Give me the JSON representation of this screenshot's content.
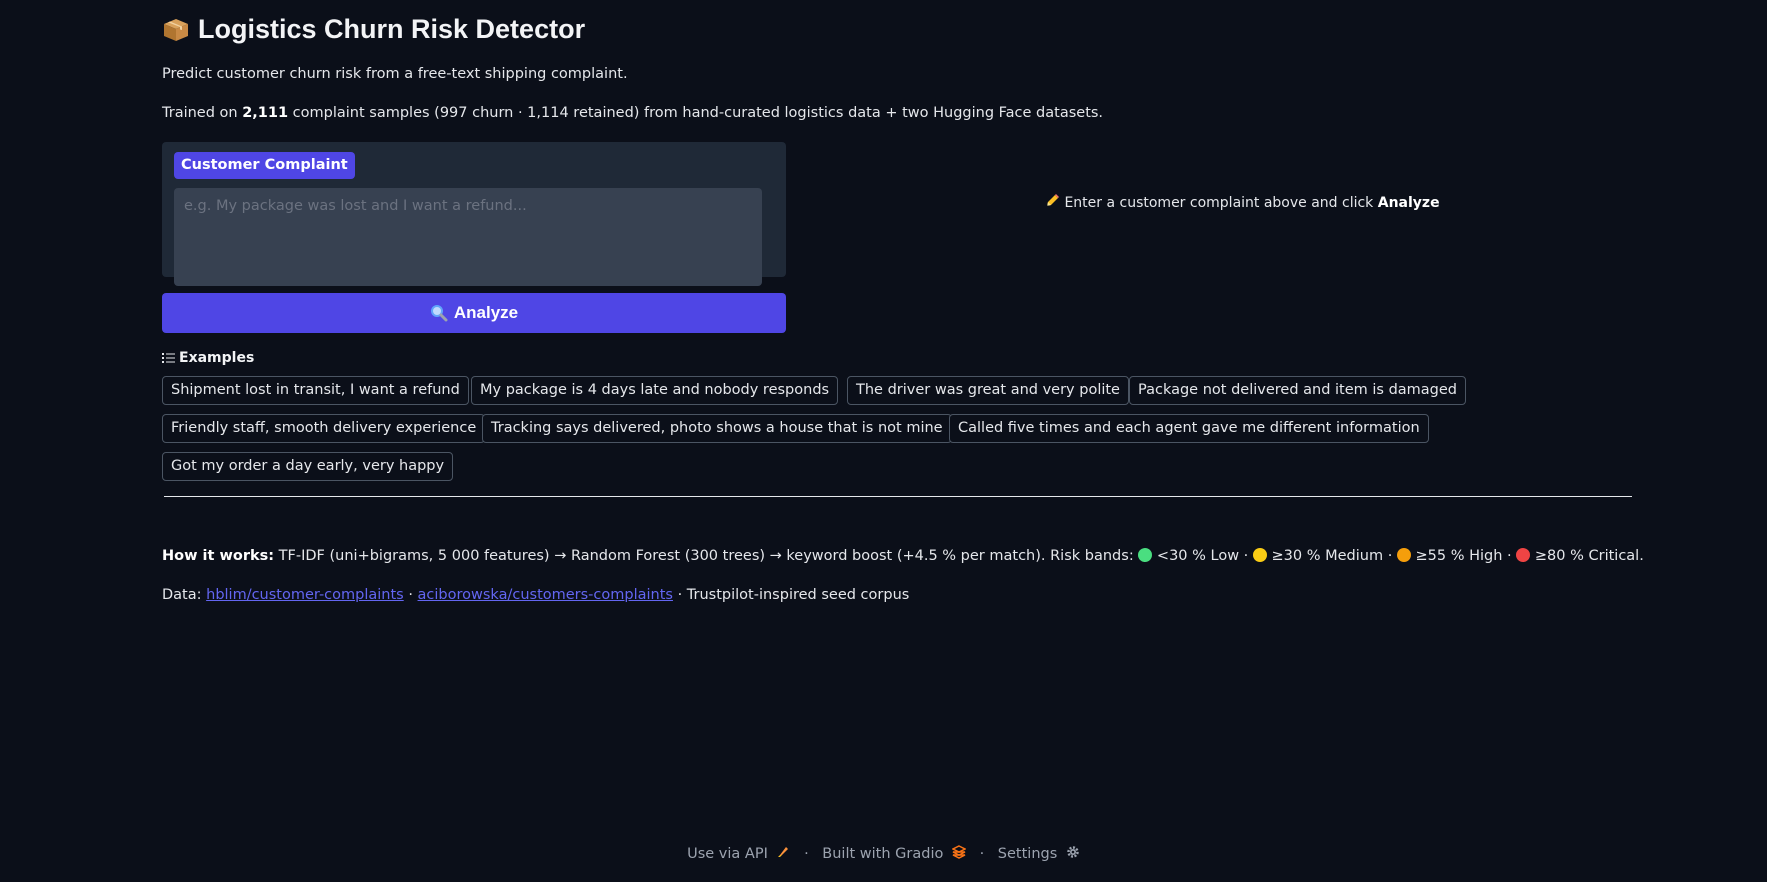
{
  "app": {
    "title": "Logistics Churn Risk Detector",
    "title_icon": "package-icon",
    "description": "Predict customer churn risk from a free-text shipping complaint.",
    "training": {
      "prefix": "Trained on ",
      "count": "2,111",
      "suffix": " complaint samples (997 churn · 1,114 retained) from hand-curated logistics data + two Hugging Face datasets."
    }
  },
  "input": {
    "label": "Customer Complaint",
    "placeholder": "e.g. My package was lost and I want a refund...",
    "value": ""
  },
  "analyze_button": {
    "label": "Analyze",
    "icon": "magnifier-icon"
  },
  "output": {
    "hint_prefix": "Enter a customer complaint above and click ",
    "hint_bold": "Analyze",
    "icon": "pencil-icon"
  },
  "examples": {
    "header": "Examples",
    "items": [
      "Shipment lost in transit, I want a refund",
      "My package is 4 days late and nobody responds",
      "The driver was great and very polite",
      "Package not delivered and item is damaged",
      "Friendly staff, smooth delivery experience",
      "Tracking says delivered, photo shows a house that is not mine",
      "Called five times and each agent gave me different information",
      "Got my order a day early, very happy"
    ]
  },
  "how_it_works": {
    "label": "How it works:",
    "text": " TF-IDF (uni+bigrams, 5 000 features) → Random Forest (300 trees) → keyword boost (+4.5 % per match). Risk bands: ",
    "bands": [
      {
        "text": " <30 % Low",
        "color": "#4ade80"
      },
      {
        "text": " ≥30 % Medium",
        "color": "#facc15"
      },
      {
        "text": " ≥55 % High",
        "color": "#f59e0b"
      },
      {
        "text": " ≥80 % Critical.",
        "color": "#ef4444"
      }
    ],
    "separator": " · "
  },
  "data_sources": {
    "label": "Data: ",
    "link1": "hblim/customer-complaints",
    "sep": " · ",
    "link2": "aciborowska/customers-complaints",
    "suffix": " · Trustpilot-inspired seed corpus"
  },
  "footer": {
    "api": "Use via API",
    "built": "Built with Gradio",
    "settings": "Settings",
    "separator": "·"
  },
  "colors": {
    "background": "#0b0f19",
    "accent": "#4f46e5",
    "panel": "#1f2937",
    "link": "#6366f1"
  }
}
